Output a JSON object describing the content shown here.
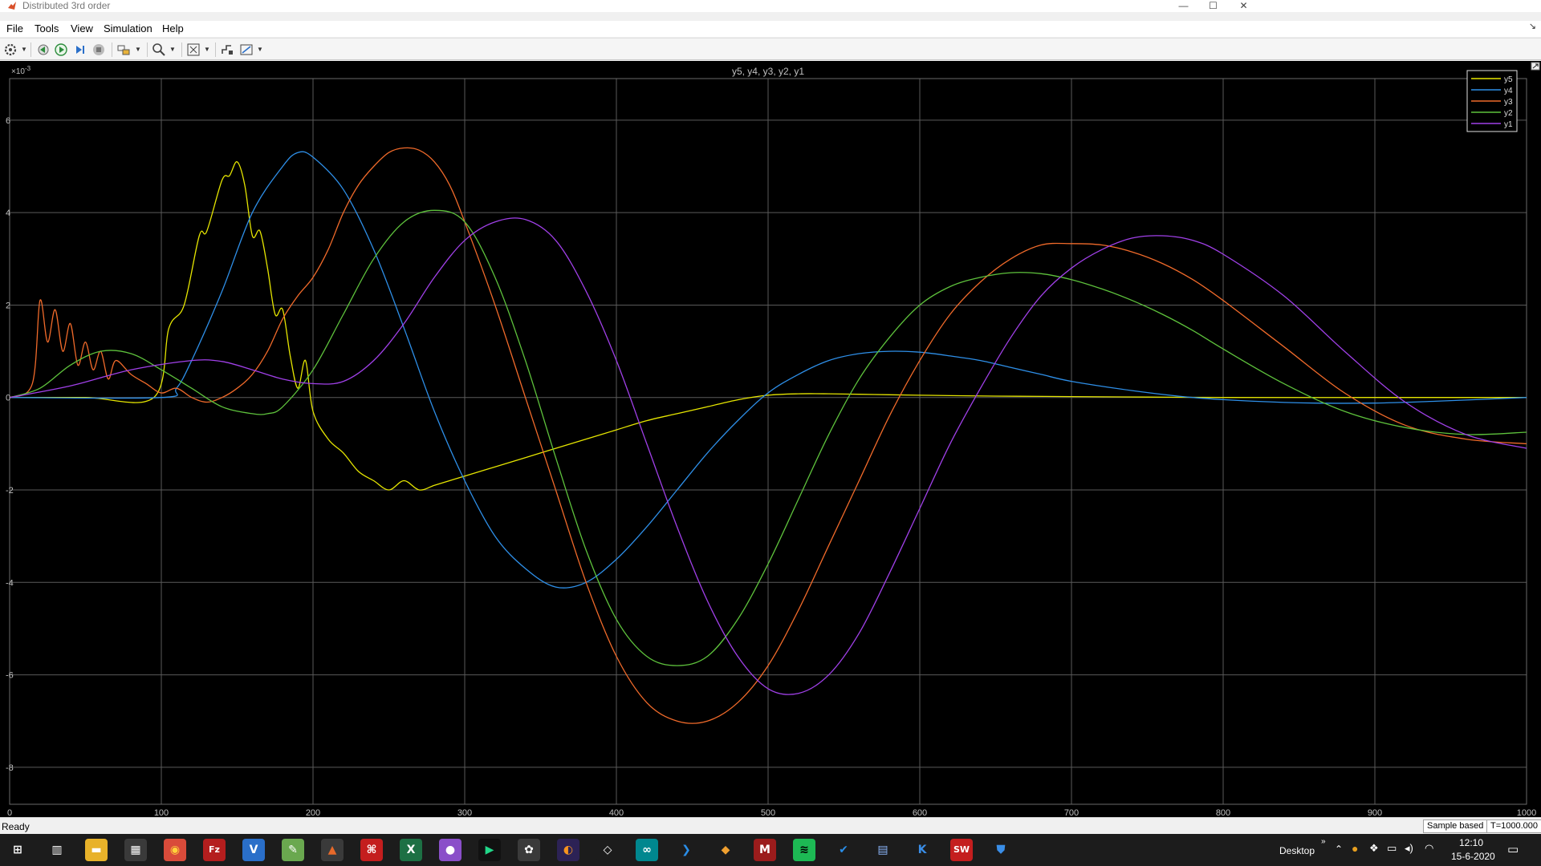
{
  "window": {
    "title": "Distributed 3rd order"
  },
  "menu": [
    "File",
    "Tools",
    "View",
    "Simulation",
    "Help"
  ],
  "toolbar": {
    "icons": [
      "settings-icon",
      "step-back-icon",
      "run-icon",
      "step-forward-icon",
      "stop-icon",
      "highlight-block-icon",
      "zoom-icon",
      "fit-to-view-icon",
      "triggers-icon",
      "cursor-measurements-icon"
    ]
  },
  "scope": {
    "title": "y5, y4, y3, y2, y1",
    "exponent_label": "×10",
    "exponent_sup": "-3",
    "background": "#000000",
    "grid_color": "#5a5a5a",
    "tick_color": "#c0c0c0",
    "xticks": [
      "0",
      "100",
      "200",
      "300",
      "400",
      "500",
      "600",
      "700",
      "800",
      "900",
      "1000"
    ],
    "yticks": [
      "6",
      "4",
      "2",
      "0",
      "-2",
      "-4",
      "-6",
      "-8"
    ],
    "legend": [
      "y5",
      "y4",
      "y3",
      "y2",
      "y1"
    ]
  },
  "chart_data": {
    "type": "line",
    "title": "y5, y4, y3, y2, y1",
    "xlabel": "",
    "ylabel": "",
    "xlim": [
      0,
      1000
    ],
    "ylim": [
      -8.8,
      6.9
    ],
    "y_scale_note": "×10^-3",
    "grid": true,
    "legend_position": "top-right",
    "series": [
      {
        "name": "y5",
        "color": "#e6e600",
        "x": [
          0,
          50,
          95,
          105,
          115,
          125,
          130,
          140,
          145,
          150,
          155,
          160,
          165,
          170,
          175,
          180,
          185,
          190,
          195,
          200,
          210,
          220,
          230,
          240,
          250,
          260,
          270,
          280,
          290,
          300,
          320,
          340,
          360,
          380,
          400,
          420,
          440,
          460,
          480,
          500,
          520,
          540,
          560,
          580,
          600,
          620,
          650,
          700,
          750,
          800,
          900,
          1000
        ],
        "y": [
          0,
          0,
          0,
          1.5,
          2.0,
          3.5,
          3.6,
          4.7,
          4.8,
          5.1,
          4.6,
          3.5,
          3.6,
          2.8,
          1.8,
          1.9,
          0.9,
          0.2,
          0.8,
          -0.3,
          -0.9,
          -1.2,
          -1.6,
          -1.8,
          -2.0,
          -1.8,
          -2.0,
          -1.9,
          -1.8,
          -1.7,
          -1.5,
          -1.3,
          -1.1,
          -0.9,
          -0.7,
          -0.5,
          -0.35,
          -0.2,
          -0.05,
          0.05,
          0.08,
          0.08,
          0.07,
          0.06,
          0.05,
          0.04,
          0.03,
          0.02,
          0.01,
          0.0,
          0.0,
          0.0
        ]
      },
      {
        "name": "y4",
        "color": "#2e8fe8",
        "x": [
          0,
          100,
          110,
          120,
          140,
          160,
          180,
          190,
          200,
          220,
          240,
          260,
          280,
          300,
          320,
          340,
          360,
          380,
          400,
          420,
          440,
          460,
          480,
          500,
          520,
          540,
          560,
          580,
          600,
          620,
          640,
          660,
          680,
          700,
          740,
          780,
          820,
          860,
          900,
          940,
          1000
        ],
        "y": [
          0,
          0,
          0.2,
          0.8,
          2.3,
          4.0,
          5.0,
          5.3,
          5.2,
          4.5,
          3.2,
          1.5,
          -0.3,
          -1.8,
          -3.0,
          -3.7,
          -4.1,
          -4.0,
          -3.5,
          -2.8,
          -2.0,
          -1.2,
          -0.5,
          0.1,
          0.5,
          0.8,
          0.95,
          1.0,
          0.98,
          0.9,
          0.8,
          0.65,
          0.5,
          0.35,
          0.15,
          0.0,
          -0.08,
          -0.12,
          -0.12,
          -0.08,
          0.0
        ]
      },
      {
        "name": "y3",
        "color": "#f06a2a",
        "x": [
          0,
          15,
          20,
          25,
          30,
          35,
          40,
          45,
          50,
          55,
          60,
          65,
          70,
          80,
          90,
          100,
          110,
          120,
          130,
          140,
          150,
          160,
          170,
          180,
          190,
          200,
          210,
          220,
          230,
          240,
          250,
          260,
          270,
          280,
          290,
          300,
          320,
          340,
          360,
          380,
          400,
          420,
          440,
          460,
          480,
          500,
          520,
          540,
          560,
          580,
          600,
          620,
          640,
          660,
          680,
          700,
          720,
          740,
          760,
          780,
          800,
          840,
          880,
          920,
          960,
          1000
        ],
        "y": [
          0,
          0.3,
          2.1,
          1.2,
          1.9,
          1.0,
          1.6,
          0.7,
          1.2,
          0.6,
          1.0,
          0.4,
          0.8,
          0.5,
          0.3,
          0.1,
          0.2,
          0.0,
          -0.1,
          0.0,
          0.2,
          0.5,
          1.0,
          1.7,
          2.2,
          2.6,
          3.2,
          4.0,
          4.6,
          5.0,
          5.3,
          5.4,
          5.35,
          5.1,
          4.6,
          3.8,
          2.0,
          0.0,
          -2.0,
          -4.0,
          -5.6,
          -6.6,
          -7.0,
          -7.0,
          -6.6,
          -5.8,
          -4.6,
          -3.2,
          -1.8,
          -0.4,
          0.8,
          1.8,
          2.5,
          3.0,
          3.3,
          3.33,
          3.3,
          3.15,
          2.9,
          2.55,
          2.1,
          1.1,
          0.1,
          -0.6,
          -0.9,
          -1.0
        ]
      },
      {
        "name": "y2",
        "color": "#5ec23c",
        "x": [
          0,
          20,
          40,
          60,
          80,
          100,
          120,
          140,
          160,
          170,
          180,
          200,
          220,
          240,
          260,
          280,
          300,
          320,
          340,
          360,
          380,
          400,
          420,
          440,
          460,
          480,
          500,
          520,
          540,
          560,
          580,
          600,
          620,
          640,
          660,
          680,
          700,
          720,
          740,
          760,
          780,
          800,
          840,
          880,
          920,
          960,
          1000
        ],
        "y": [
          0,
          0.2,
          0.7,
          1.0,
          0.95,
          0.6,
          0.2,
          -0.2,
          -0.35,
          -0.35,
          -0.2,
          0.6,
          1.8,
          3.0,
          3.8,
          4.05,
          3.8,
          2.6,
          0.8,
          -1.3,
          -3.3,
          -4.8,
          -5.6,
          -5.8,
          -5.6,
          -4.8,
          -3.6,
          -2.2,
          -0.8,
          0.4,
          1.3,
          2.0,
          2.4,
          2.6,
          2.7,
          2.68,
          2.55,
          2.35,
          2.1,
          1.8,
          1.45,
          1.05,
          0.3,
          -0.3,
          -0.65,
          -0.8,
          -0.75
        ]
      },
      {
        "name": "y1",
        "color": "#a040e8",
        "x": [
          0,
          40,
          80,
          120,
          140,
          160,
          180,
          200,
          220,
          240,
          260,
          280,
          300,
          320,
          340,
          360,
          380,
          400,
          420,
          440,
          460,
          480,
          500,
          520,
          540,
          560,
          580,
          600,
          620,
          640,
          660,
          680,
          700,
          720,
          740,
          760,
          780,
          800,
          840,
          880,
          920,
          960,
          1000
        ],
        "y": [
          0,
          0.25,
          0.6,
          0.8,
          0.78,
          0.6,
          0.4,
          0.3,
          0.35,
          0.8,
          1.6,
          2.6,
          3.4,
          3.8,
          3.85,
          3.4,
          2.3,
          0.8,
          -1.0,
          -2.8,
          -4.4,
          -5.6,
          -6.3,
          -6.4,
          -6.0,
          -5.1,
          -3.8,
          -2.4,
          -1.0,
          0.2,
          1.3,
          2.2,
          2.8,
          3.2,
          3.45,
          3.5,
          3.4,
          3.1,
          2.2,
          1.0,
          -0.1,
          -0.8,
          -1.1
        ]
      }
    ]
  },
  "status": {
    "text": "Ready",
    "mode": "Sample based",
    "time": "T=1000.000"
  },
  "taskbar": {
    "apps": [
      "windows-start-icon",
      "task-view-icon",
      "file-explorer-icon",
      "calculator-icon",
      "chrome-icon",
      "filezilla-icon",
      "vscode-alt-icon",
      "notepad-icon",
      "matlab-icon",
      "acrobat-icon",
      "excel-icon",
      "app-purple-icon",
      "pycharm-icon",
      "inkscape-icon",
      "eclipse-icon",
      "logisim-icon",
      "arduino-icon",
      "vscode-icon",
      "git-icon",
      "mendeley-icon",
      "spotify-icon",
      "teams-task-icon",
      "network-monitor-icon",
      "kicad-icon",
      "solidworks-icon",
      "security-icon"
    ],
    "desktop_label": "Desktop",
    "time": "12:10",
    "date": "15-6-2020"
  }
}
